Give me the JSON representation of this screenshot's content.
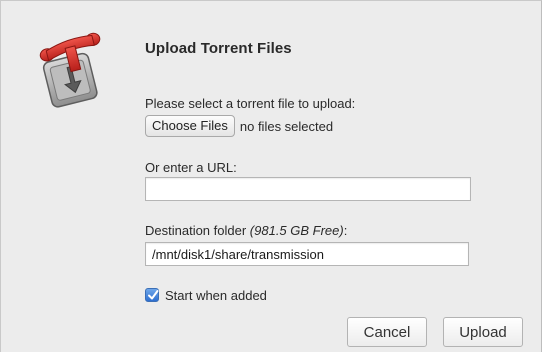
{
  "dialog": {
    "title": "Upload Torrent Files",
    "app_icon": "transmission-app-icon"
  },
  "file_select": {
    "label": "Please select a torrent file to upload:",
    "choose_button": "Choose Files",
    "status": "no files selected"
  },
  "url": {
    "label": "Or enter a URL:",
    "value": ""
  },
  "destination": {
    "label": "Destination folder",
    "free_space": "(981.5 GB Free)",
    "suffix": ":",
    "value": "/mnt/disk1/share/transmission"
  },
  "start_when_added": {
    "label": "Start when added",
    "checked": true
  },
  "buttons": {
    "cancel": "Cancel",
    "upload": "Upload"
  },
  "colors": {
    "dialog_background": "#ececec",
    "checkbox_accent": "#2d6fd0",
    "icon_red": "#d9322b"
  }
}
